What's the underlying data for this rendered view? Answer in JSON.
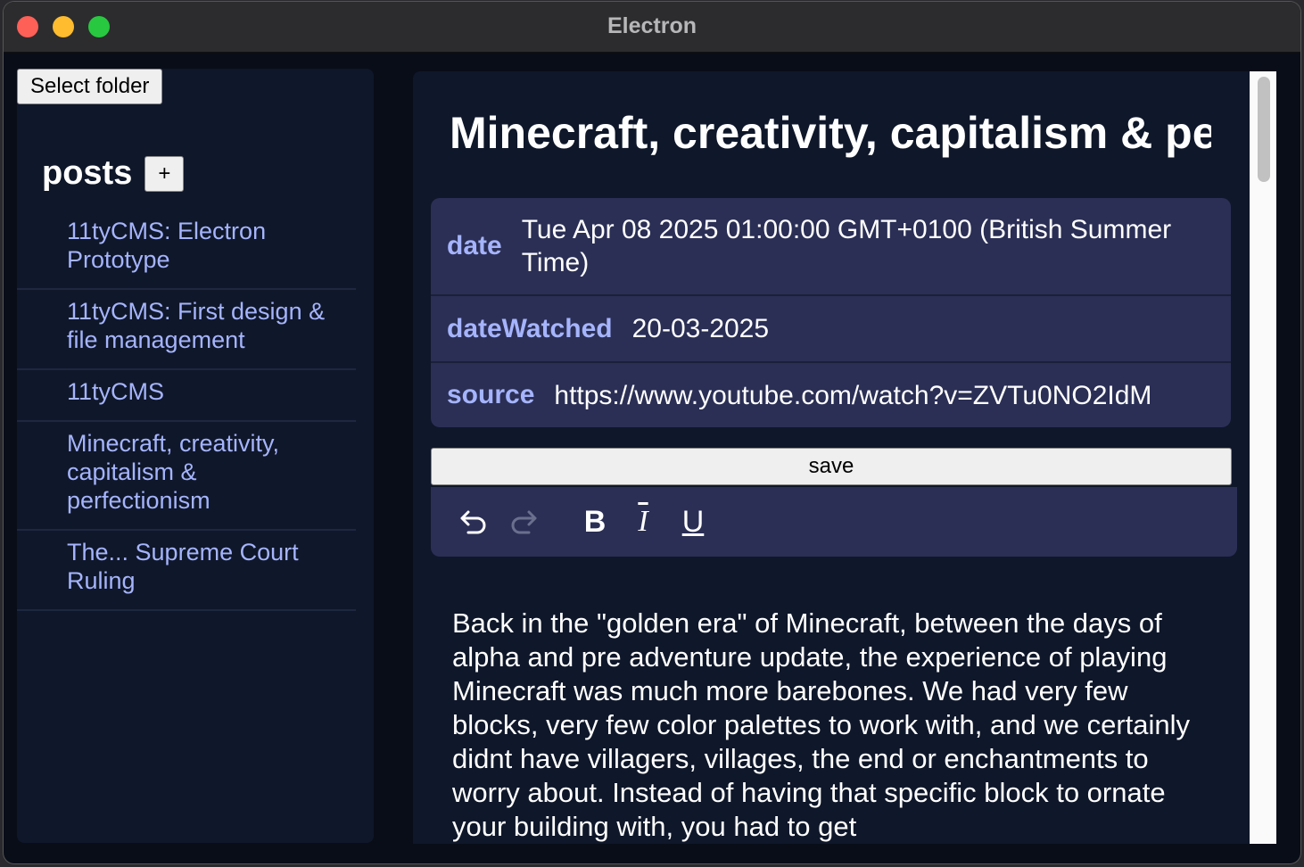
{
  "window": {
    "title": "Electron"
  },
  "sidebar": {
    "select_folder_label": "Select folder",
    "posts_title": "posts",
    "add_label": "+",
    "posts": [
      "11tyCMS: Electron Prototype",
      "11tyCMS: First design & file management",
      "11tyCMS",
      "Minecraft, creativity, capitalism & perfectionism",
      "The... Supreme Court Ruling"
    ]
  },
  "editor": {
    "title": "Minecraft, creativity, capitalism & perfectionism",
    "meta": [
      {
        "key": "date",
        "value": "Tue Apr 08 2025 01:00:00 GMT+0100 (British Summer Time)"
      },
      {
        "key": "dateWatched",
        "value": "20-03-2025"
      },
      {
        "key": "source",
        "value": "https://www.youtube.com/watch?v=ZVTu0NO2IdM"
      }
    ],
    "save_label": "save",
    "toolbar": {
      "bold": "B",
      "italic": "I",
      "underline": "U"
    },
    "body": "Back in the \"golden era\" of Minecraft, between the days of alpha and pre adventure update, the experience of playing Minecraft was much more barebones. We had very few blocks, very few color palettes to work with, and we certainly didnt have villagers, villages, the end or enchantments to worry about. Instead of having that specific block to ornate your building with, you had to get"
  },
  "colors": {
    "accent": "#a5b4fc",
    "panel": "#2b2f55",
    "background": "#0f172a"
  }
}
